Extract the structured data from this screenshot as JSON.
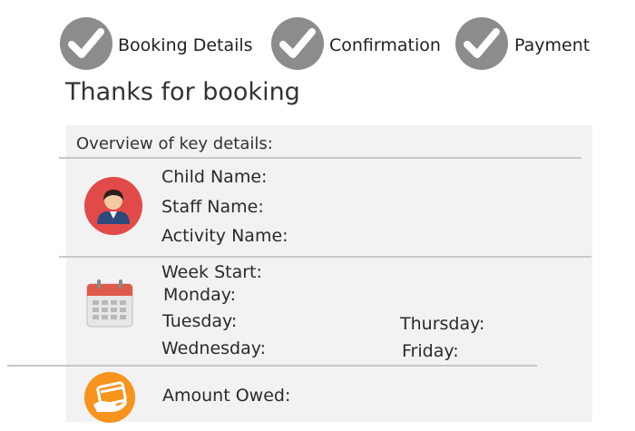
{
  "steps": [
    {
      "label": "Booking Details",
      "icon": "check-icon"
    },
    {
      "label": "Confirmation",
      "icon": "check-icon"
    },
    {
      "label": "Payment",
      "icon": "check-icon"
    }
  ],
  "page_title": "Thanks for booking",
  "card": {
    "heading": "Overview of key details:",
    "person_section": {
      "icon": "person-icon",
      "child_name_label": "Child Name:",
      "staff_name_label": "Staff  Name:",
      "activity_name_label": "Activity Name:"
    },
    "schedule_section": {
      "icon": "calendar-icon",
      "week_start_label": "Week Start:",
      "monday_label": "Monday:",
      "tuesday_label": "Tuesday:",
      "wednesday_label": "Wednesday:",
      "thursday_label": "Thursday:",
      "friday_label": "Friday:"
    },
    "payment_section": {
      "icon": "payment-card-icon",
      "amount_owed_label": "Amount Owed:"
    }
  },
  "colors": {
    "step_circle": "#8c8c8c",
    "card_bg": "#f2f2f2",
    "person_icon_bg": "#e24a4a",
    "calendar_red": "#e05a4a",
    "payment_icon_bg": "#f7941d"
  }
}
